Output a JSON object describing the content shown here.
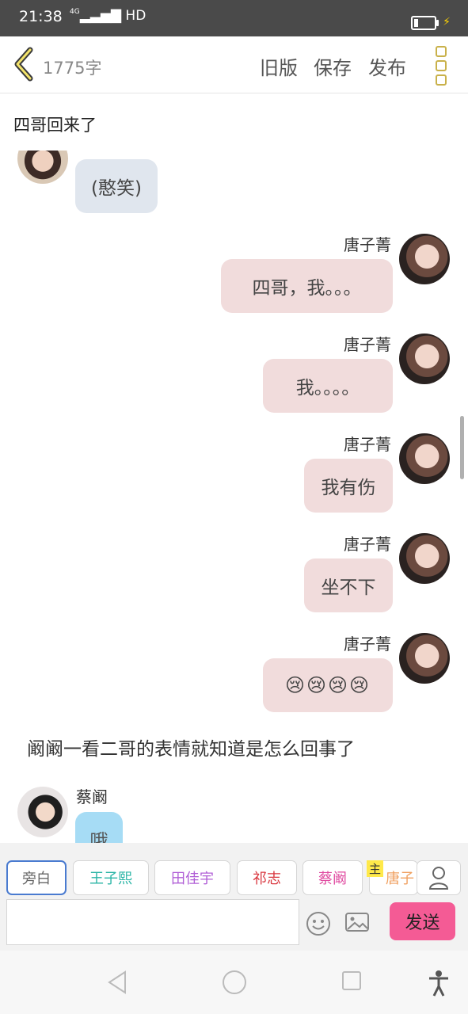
{
  "status_bar": {
    "time": "21:38",
    "signal": "4G",
    "network": "HD"
  },
  "header": {
    "word_count": "1775字",
    "buttons": [
      "旧版",
      "保存",
      "发布"
    ]
  },
  "chapter_title": "四哥回来了",
  "messages": [
    {
      "side": "left",
      "sender": "",
      "text": "(憨笑)"
    },
    {
      "side": "right",
      "sender": "唐子菁",
      "text": "四哥，我。。。"
    },
    {
      "side": "right",
      "sender": "唐子菁",
      "text": "我。。。。"
    },
    {
      "side": "right",
      "sender": "唐子菁",
      "text": "我有伤"
    },
    {
      "side": "right",
      "sender": "唐子菁",
      "text": "坐不下"
    },
    {
      "side": "right",
      "sender": "唐子菁",
      "text": "😢😢😢😢"
    },
    {
      "side": "narration",
      "text": "阚阚一看二哥的表情就知道是怎么回事了"
    },
    {
      "side": "left",
      "sender": "蔡阚",
      "text": "哦"
    }
  ],
  "roles": [
    {
      "label": "旁白",
      "color": "#666666",
      "active": true
    },
    {
      "label": "王子熙",
      "color": "#2bb5a6"
    },
    {
      "label": "田佳宇",
      "color": "#b05ed6"
    },
    {
      "label": "祁志",
      "color": "#d9363e"
    },
    {
      "label": "蔡阚",
      "color": "#e04aa0"
    },
    {
      "label": "唐子",
      "color": "#f0a060",
      "tag": "主"
    }
  ],
  "input": {
    "placeholder": ""
  },
  "send_label": "发送",
  "colors": {
    "send": "#f45b95",
    "bubble_right": "#f1dcdc",
    "bubble_left": "#e0e6ee",
    "bubble_blue": "#a6dcf5"
  }
}
